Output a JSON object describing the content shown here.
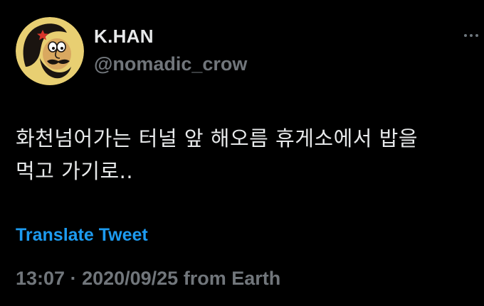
{
  "author": {
    "display_name": "K.HAN",
    "handle": "@nomadic_crow",
    "avatar_icon": "cartoon-avatar-icon"
  },
  "menu": {
    "icon": "more-options-icon"
  },
  "tweet": {
    "text_lines": [
      "화천넘어가는 터널 앞 해오름 휴게소에서 밥을",
      "먹고 가기로.."
    ],
    "translate_label": "Translate Tweet"
  },
  "meta": {
    "time": "13:07",
    "separator": " · ",
    "date": "2020/09/25",
    "source": " from Earth"
  },
  "colors": {
    "background": "#000000",
    "primary_text": "#e7e9ea",
    "secondary_text": "#71767b",
    "link": "#1d9bf0"
  }
}
